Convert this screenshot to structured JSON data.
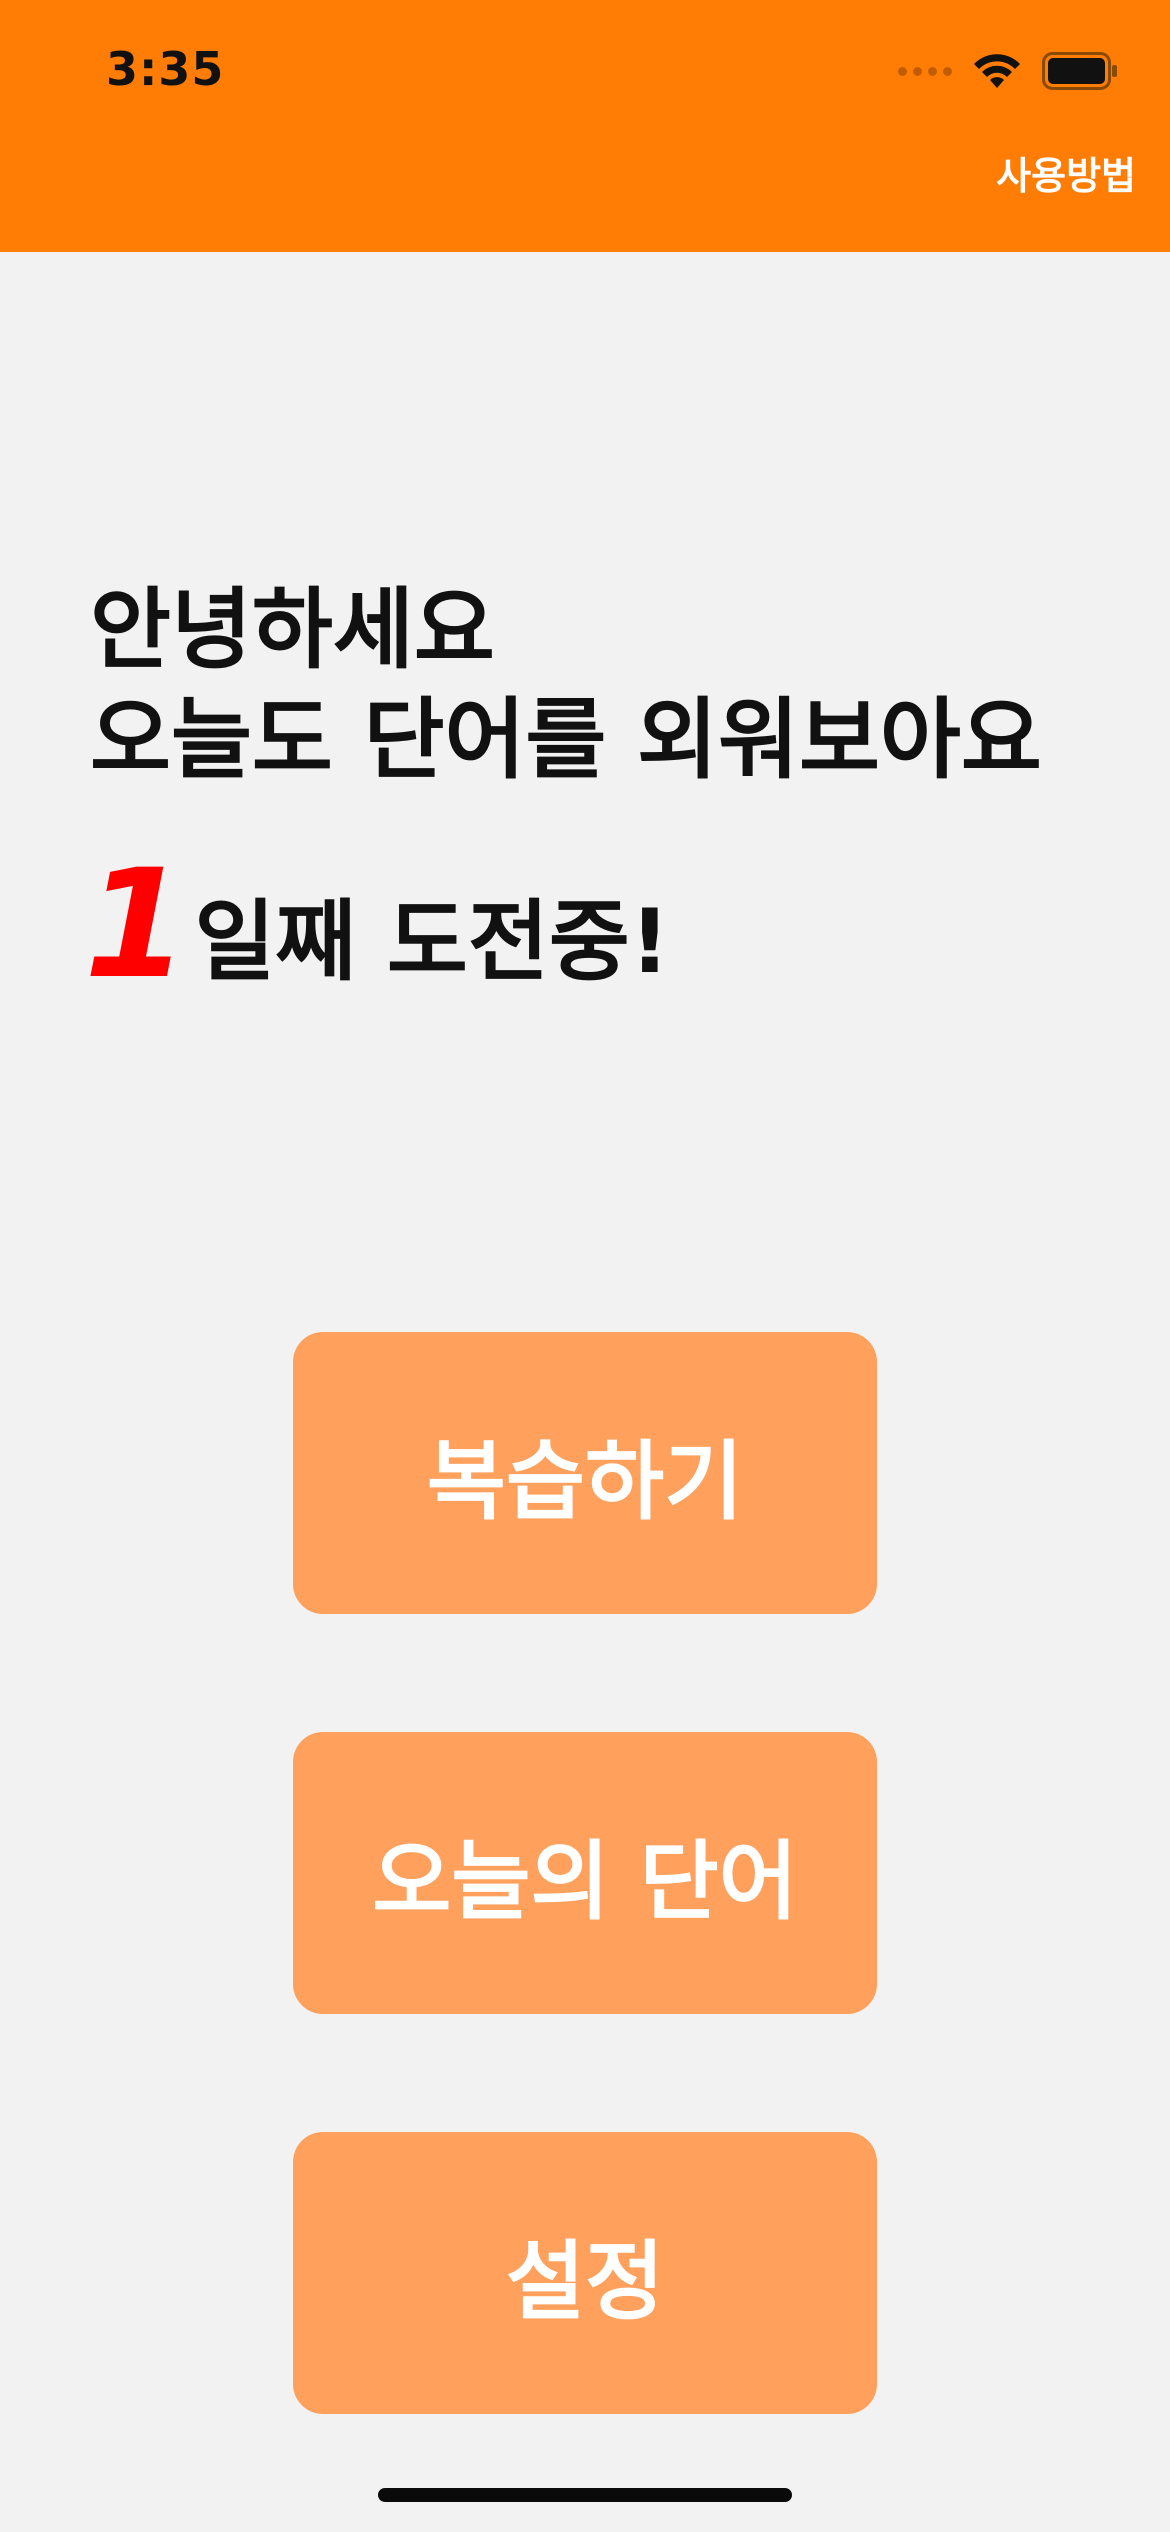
{
  "status_bar": {
    "time": "3:35",
    "icons": [
      "cellular-signal-icon",
      "wifi-icon",
      "battery-icon"
    ]
  },
  "nav": {
    "help_label": "사용방법"
  },
  "greeting": {
    "line1": "안녕하세요",
    "line2": "오늘도 단어를 외워보아요"
  },
  "challenge": {
    "day_count": "1",
    "text": "일째 도전중!"
  },
  "menu": {
    "review_label": "복습하기",
    "today_word_label": "오늘의 단어",
    "settings_label": "설정"
  },
  "colors": {
    "header": "#ff7d05",
    "button": "#ffa05d",
    "background": "#f2f2f2",
    "day_count": "#ff0000"
  }
}
